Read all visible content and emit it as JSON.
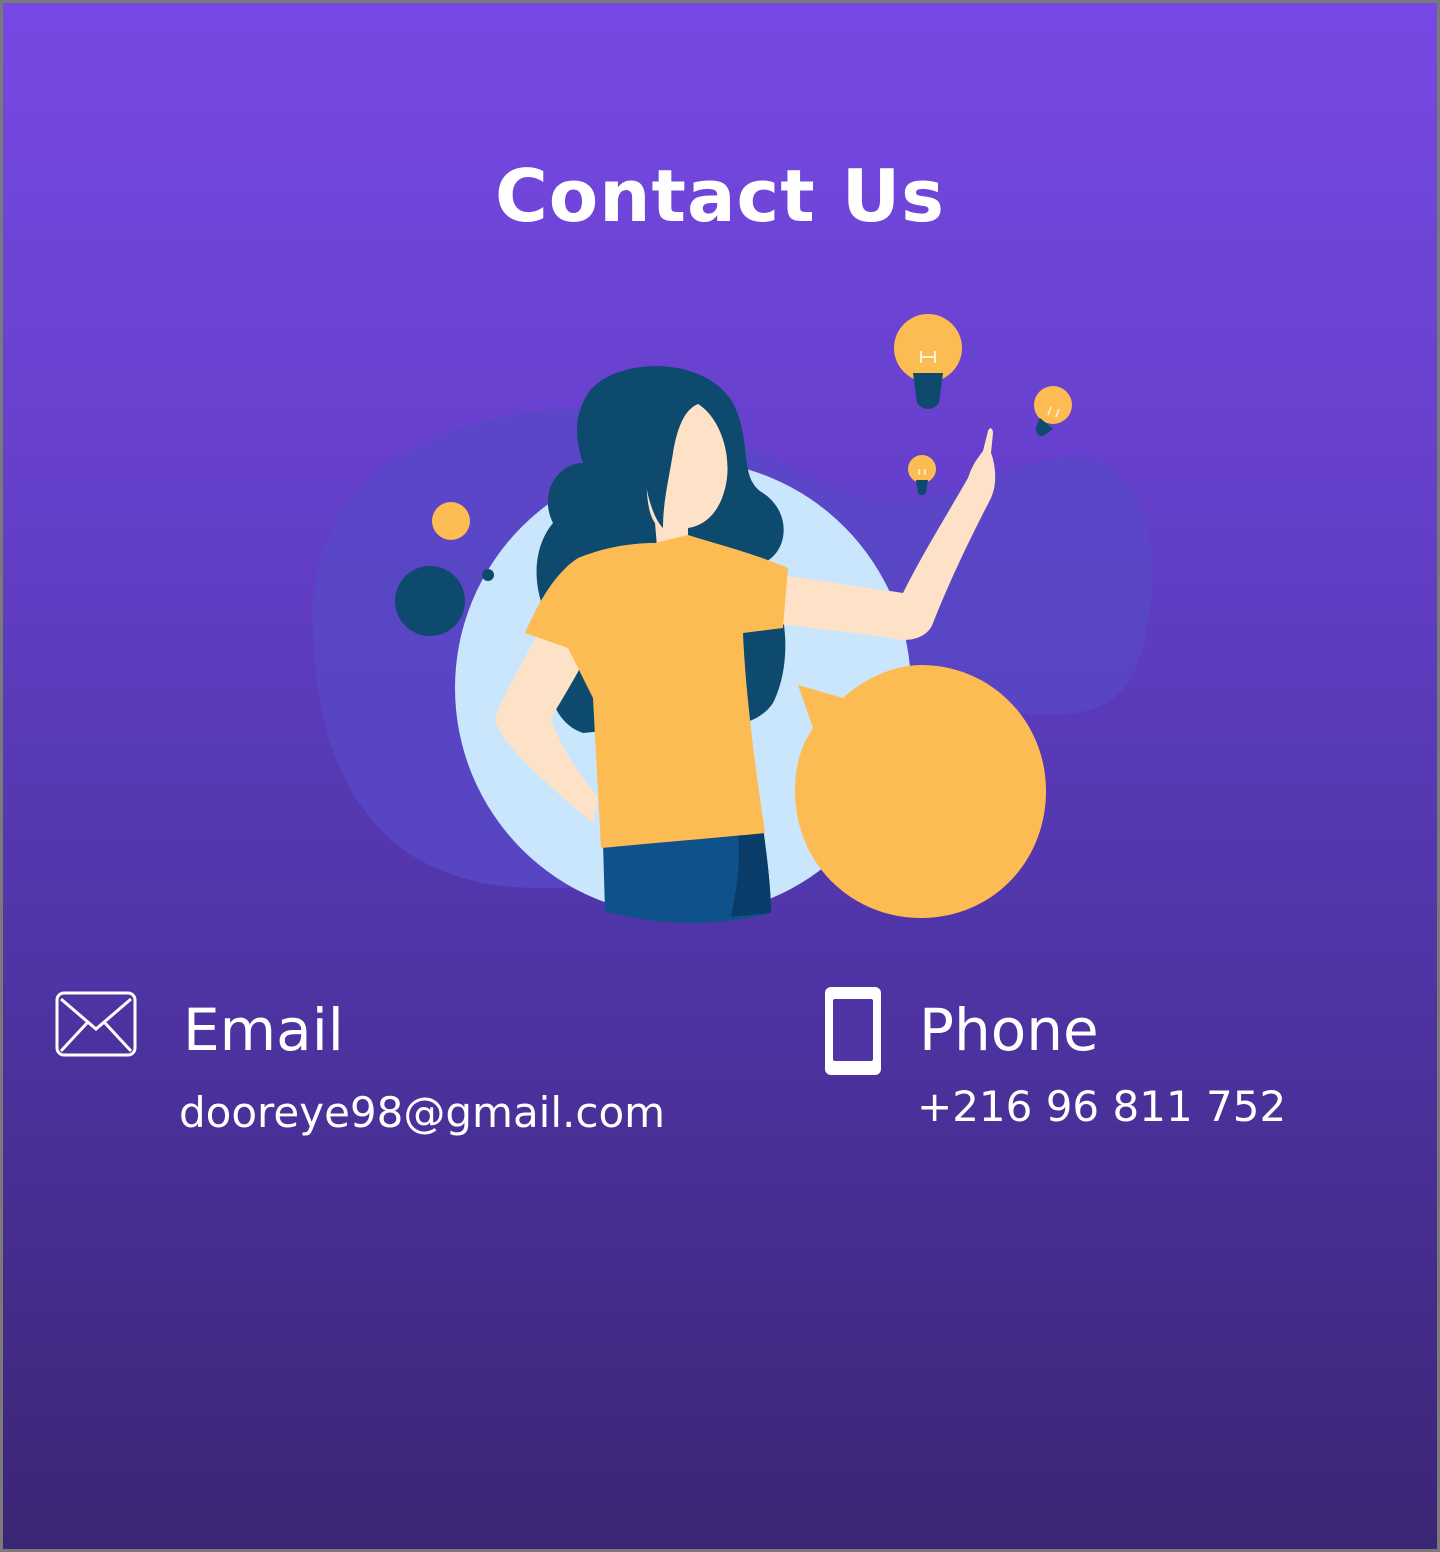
{
  "page": {
    "title": "Contact Us"
  },
  "illustration": {
    "name": "woman-pointing-lightbulbs-illustration"
  },
  "contacts": {
    "email": {
      "label": "Email",
      "value": "dooreye98@gmail.com",
      "icon": "envelope-icon"
    },
    "phone": {
      "label": "Phone",
      "value": "+216 96 811 752",
      "icon": "phone-icon"
    }
  },
  "colors": {
    "gradient_top": "#7749e4",
    "gradient_bottom": "#3b2575",
    "accent_yellow": "#fdbc53",
    "navy": "#0d4a6e",
    "light_blue": "#cae6fd",
    "skin": "#fde2c8",
    "text": "#ffffff"
  }
}
